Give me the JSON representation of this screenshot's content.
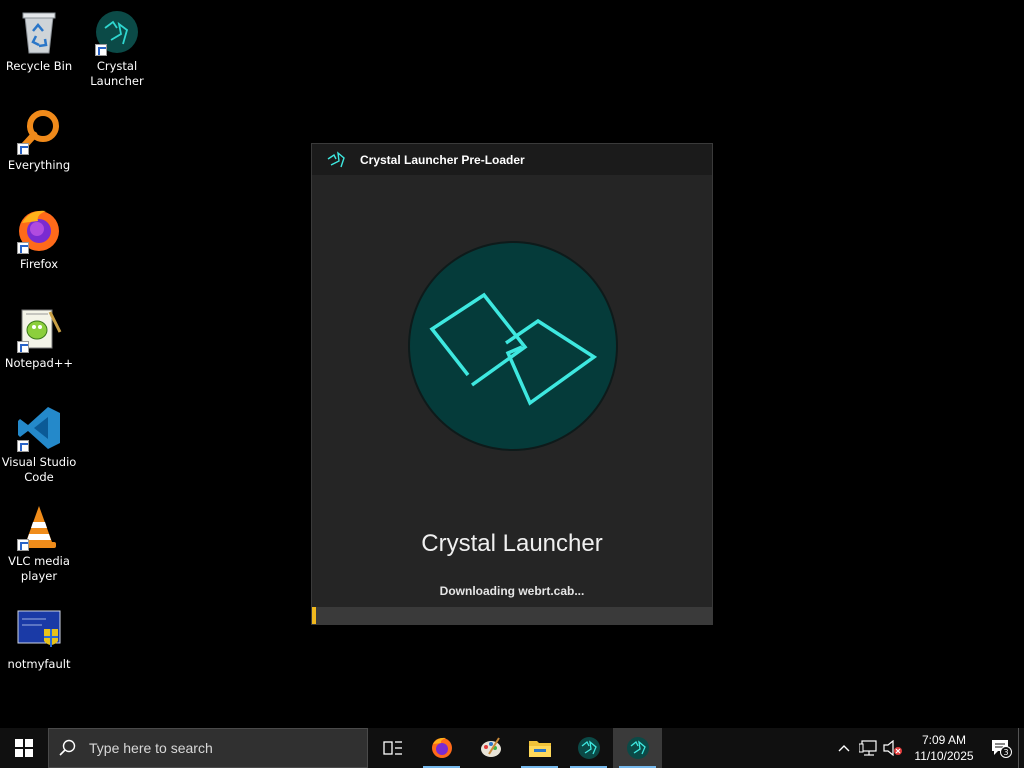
{
  "desktop": {
    "icons": [
      {
        "label": "Recycle Bin",
        "icon": "recycle-bin-icon"
      },
      {
        "label": "Crystal Launcher",
        "icon": "crystal-launcher-icon"
      },
      {
        "label": "Everything",
        "icon": "everything-search-icon"
      },
      {
        "label": "Firefox",
        "icon": "firefox-icon"
      },
      {
        "label": "Notepad++",
        "icon": "notepad-plus-plus-icon"
      },
      {
        "label": "Visual Studio Code",
        "icon": "vscode-icon"
      },
      {
        "label": "VLC media player",
        "icon": "vlc-icon"
      },
      {
        "label": "notmyfault",
        "icon": "notmyfault-icon"
      }
    ]
  },
  "window": {
    "title": "Crystal Launcher Pre-Loader",
    "app_name": "Crystal Launcher",
    "status": "Downloading webrt.cab...",
    "progress_percent": 1,
    "accent_color": "#3ee8e0",
    "progress_color": "#f0b81e"
  },
  "taskbar": {
    "search_placeholder": "Type here to search",
    "time": "7:09 AM",
    "date": "11/10/2025",
    "notification_count": "3",
    "pinned": [
      "task-view-icon",
      "firefox-icon",
      "paint-icon",
      "file-explorer-icon",
      "crystal-launcher-icon",
      "crystal-launcher-icon"
    ]
  }
}
